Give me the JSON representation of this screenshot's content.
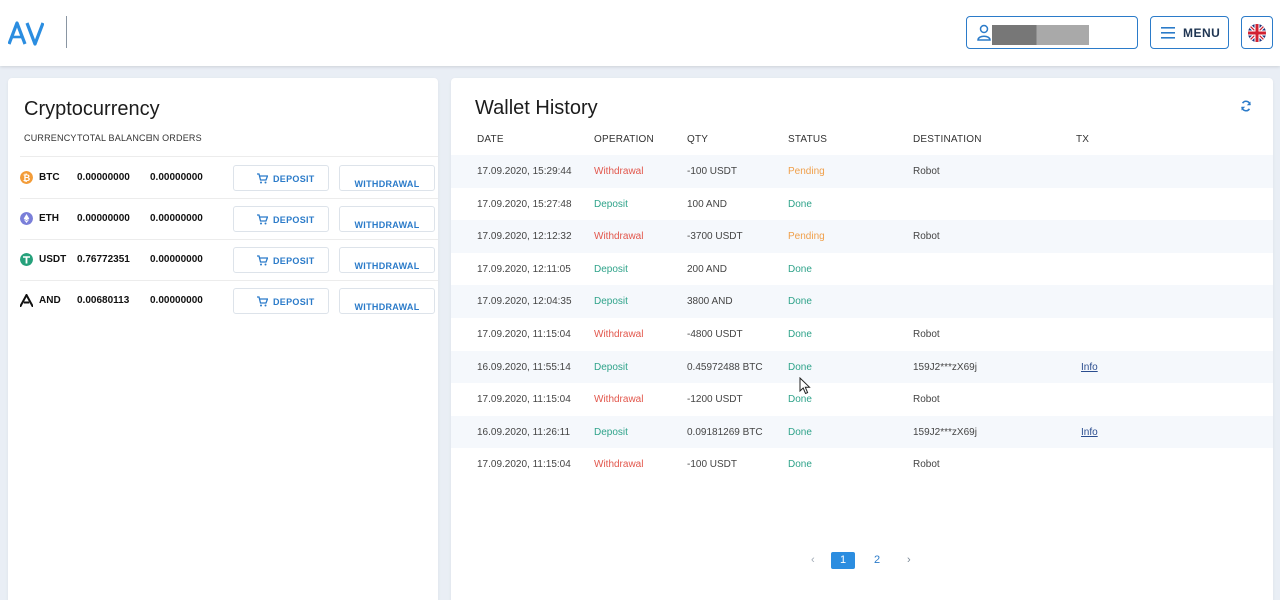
{
  "header": {
    "logo_text": "AV",
    "menu_label": "MENU"
  },
  "crypto": {
    "title": "Cryptocurrency",
    "columns": [
      "CURRENCY",
      "TOTAL BALANCE",
      "IN ORDERS"
    ],
    "deposit_label": "DEPOSIT",
    "withdrawal_label": "WITHDRAWAL",
    "rows": [
      {
        "symbol": "BTC",
        "balance": "0.00000000",
        "in_orders": "0.00000000",
        "icon": "bitcoin-icon",
        "color": "#f39c38"
      },
      {
        "symbol": "ETH",
        "balance": "0.00000000",
        "in_orders": "0.00000000",
        "icon": "ethereum-icon",
        "color": "#7a7fd9"
      },
      {
        "symbol": "USDT",
        "balance": "0.76772351",
        "in_orders": "0.00000000",
        "icon": "tether-icon",
        "color": "#26a17b"
      },
      {
        "symbol": "AND",
        "balance": "0.00680113",
        "in_orders": "0.00000000",
        "icon": "and-token-icon",
        "color": "#111111"
      }
    ]
  },
  "wallet": {
    "title": "Wallet History",
    "columns": [
      "DATE",
      "OPERATION",
      "QTY",
      "STATUS",
      "DESTINATION",
      "TX"
    ],
    "rows": [
      {
        "date": "17.09.2020, 15:29:44",
        "operation": "Withdrawal",
        "qty": "-100  USDT",
        "status": "Pending",
        "destination": "Robot",
        "tx": ""
      },
      {
        "date": "17.09.2020, 15:27:48",
        "operation": "Deposit",
        "qty": "100  AND",
        "status": "Done",
        "destination": "",
        "tx": ""
      },
      {
        "date": "17.09.2020, 12:12:32",
        "operation": "Withdrawal",
        "qty": "-3700  USDT",
        "status": "Pending",
        "destination": "Robot",
        "tx": ""
      },
      {
        "date": "17.09.2020, 12:11:05",
        "operation": "Deposit",
        "qty": "200  AND",
        "status": "Done",
        "destination": "",
        "tx": ""
      },
      {
        "date": "17.09.2020, 12:04:35",
        "operation": "Deposit",
        "qty": "3800  AND",
        "status": "Done",
        "destination": "",
        "tx": ""
      },
      {
        "date": "17.09.2020, 11:15:04",
        "operation": "Withdrawal",
        "qty": "-4800  USDT",
        "status": "Done",
        "destination": "Robot",
        "tx": ""
      },
      {
        "date": "16.09.2020, 11:55:14",
        "operation": "Deposit",
        "qty": "0.45972488  BTC",
        "status": "Done",
        "destination": "159J2***zX69j",
        "tx": "Info"
      },
      {
        "date": "17.09.2020, 11:15:04",
        "operation": "Withdrawal",
        "qty": "-1200  USDT",
        "status": "Done",
        "destination": "Robot",
        "tx": ""
      },
      {
        "date": "16.09.2020, 11:26:11",
        "operation": "Deposit",
        "qty": "0.09181269  BTC",
        "status": "Done",
        "destination": "159J2***zX69j",
        "tx": "Info"
      },
      {
        "date": "17.09.2020, 11:15:04",
        "operation": "Withdrawal",
        "qty": "-100  USDT",
        "status": "Done",
        "destination": "Robot",
        "tx": ""
      }
    ],
    "pagination": {
      "prev": "‹",
      "pages": [
        "1",
        "2"
      ],
      "current": "1",
      "next": "›"
    }
  },
  "colors": {
    "accent": "#2b7bc9",
    "withdrawal": "#e2574c",
    "deposit": "#2fa38a",
    "pending": "#f0a04b"
  }
}
